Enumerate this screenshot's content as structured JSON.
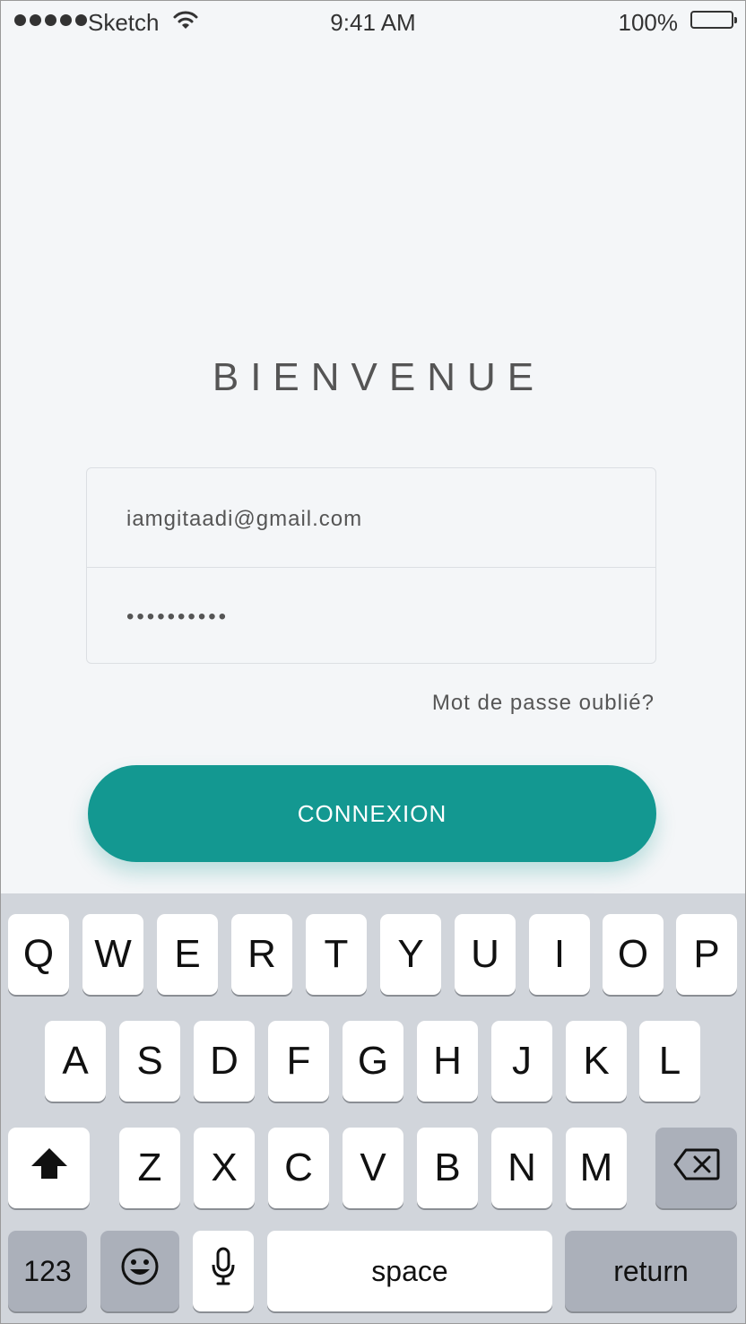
{
  "status_bar": {
    "carrier": "Sketch",
    "time": "9:41 AM",
    "battery": "100%"
  },
  "title": "BIENVENUE",
  "form": {
    "email_value": "iamgitaadi@gmail.com",
    "password_value": "••••••••••"
  },
  "forgot_password": "Mot de passe oublié?",
  "login_button": "CONNEXION",
  "keyboard": {
    "row1": [
      "Q",
      "W",
      "E",
      "R",
      "T",
      "Y",
      "U",
      "I",
      "O",
      "P"
    ],
    "row2": [
      "A",
      "S",
      "D",
      "F",
      "G",
      "H",
      "J",
      "K",
      "L"
    ],
    "row3": [
      "Z",
      "X",
      "C",
      "V",
      "B",
      "N",
      "M"
    ],
    "numbers": "123",
    "space": "space",
    "return": "return",
    "icons": {
      "shift": "shift-icon",
      "delete": "backspace-icon",
      "emoji": "emoji-icon",
      "mic": "microphone-icon"
    }
  },
  "colors": {
    "accent": "#139891",
    "background": "#f4f6f8",
    "keyboard": "#d1d5db"
  }
}
